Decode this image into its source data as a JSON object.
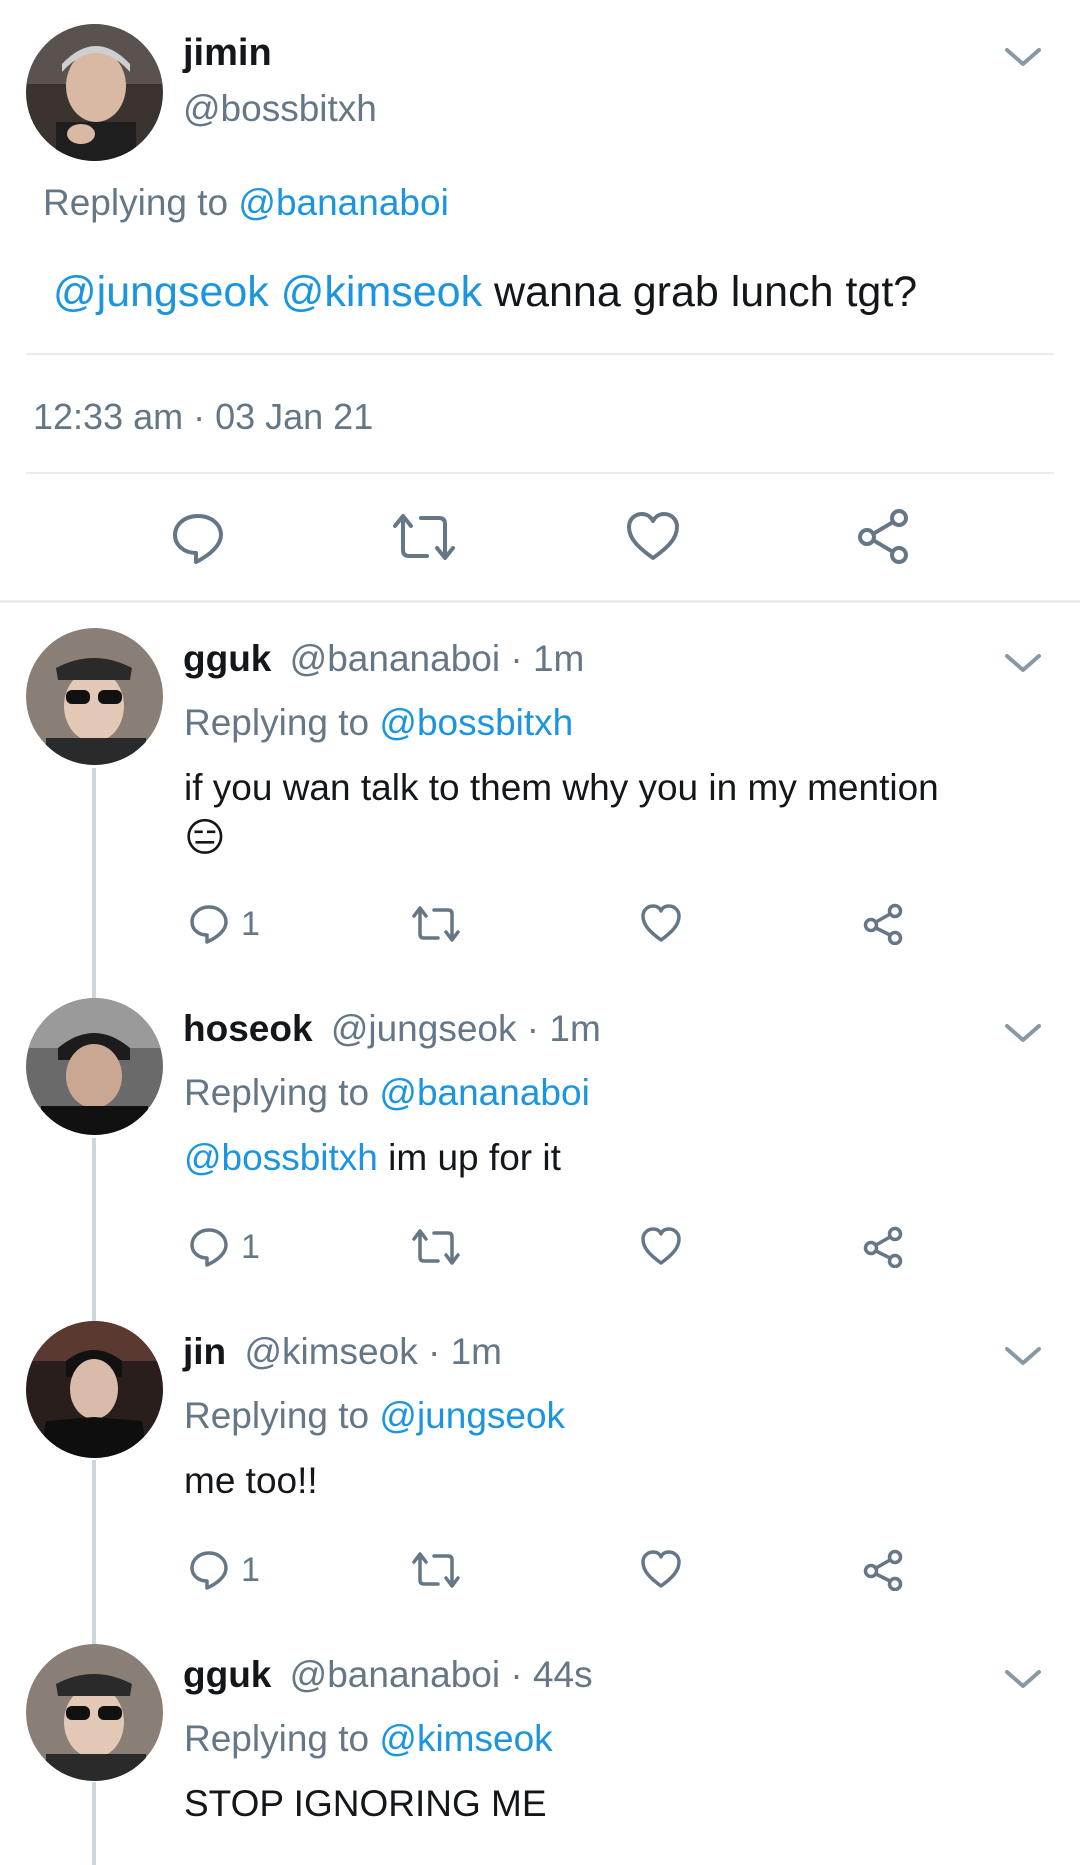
{
  "main_tweet": {
    "display_name": "jimin",
    "handle": "@bossbitxh",
    "replying_prefix": "Replying to",
    "replying_to": "@bananaboi",
    "mention1": "@jungseok",
    "mention2": "@kimseok",
    "text": "wanna grab lunch tgt?",
    "timestamp": "12:33 am · 03 Jan 21",
    "avatar_icon": "avatar-photo"
  },
  "replies": [
    {
      "display_name": "gguk",
      "handle": "@bananaboi",
      "time": "· 1m",
      "replying_prefix": "Replying to",
      "replying_to": "@bossbitxh",
      "text": "if you wan talk to them why you in my mention",
      "emoji": "😑",
      "reply_count": "1"
    },
    {
      "display_name": "hoseok",
      "handle": "@jungseok",
      "time": "· 1m",
      "replying_prefix": "Replying to",
      "replying_to": "@bananaboi",
      "mention": "@bossbitxh",
      "text": "im up for it",
      "reply_count": "1"
    },
    {
      "display_name": "jin",
      "handle": "@kimseok",
      "time": "· 1m",
      "replying_prefix": "Replying to",
      "replying_to": "@jungseok",
      "text": "me too!!",
      "reply_count": "1"
    },
    {
      "display_name": "gguk",
      "handle": "@bananaboi",
      "time": "· 44s",
      "replying_prefix": "Replying to",
      "replying_to": "@kimseok",
      "text": "STOP IGNORING ME"
    }
  ],
  "colors": {
    "link": "#1b95e0",
    "secondary_text": "#657786",
    "divider": "#e6ecf0",
    "thread_line": "#ccd6dd"
  }
}
